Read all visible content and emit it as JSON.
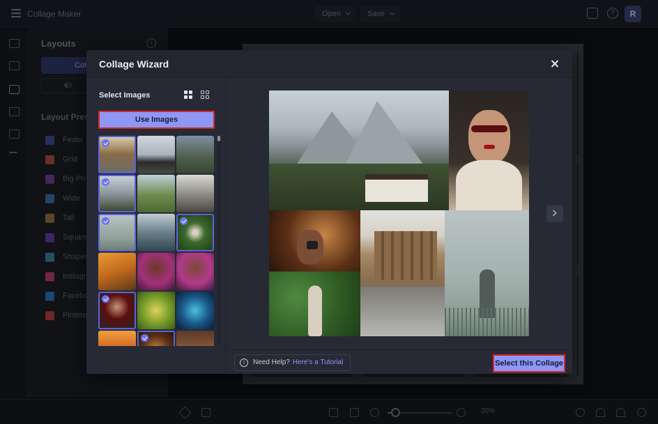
{
  "app": {
    "title": "Collage Maker",
    "menu_open": "Open",
    "menu_save": "Save",
    "avatar_initial": "R"
  },
  "left_panel": {
    "title": "Layouts",
    "tab_label": "Coll",
    "create_label": "Cr",
    "presets_title": "Layout Pres",
    "presets": [
      {
        "label": "Featu",
        "icon": "featured-icon"
      },
      {
        "label": "Grid",
        "icon": "grid-icon"
      },
      {
        "label": "Big Ph",
        "icon": "big-photo-icon"
      },
      {
        "label": "Wide",
        "icon": "wide-icon"
      },
      {
        "label": "Tall",
        "icon": "tall-icon"
      },
      {
        "label": "Square",
        "icon": "square-icon"
      },
      {
        "label": "Shapes",
        "icon": "shapes-icon"
      },
      {
        "label": "Instagr",
        "icon": "instagram-icon"
      },
      {
        "label": "Facebo",
        "icon": "facebook-icon"
      },
      {
        "label": "Pintere",
        "icon": "pinterest-icon"
      }
    ]
  },
  "wizard": {
    "title": "Collage Wizard",
    "select_images_label": "Select Images",
    "use_images_label": "Use Images",
    "help_text": "Need Help?",
    "help_link": "Here's a Tutorial",
    "select_collage_label": "Select this Collage",
    "thumbnails": [
      {
        "subject": "bath-architecture",
        "selected": true
      },
      {
        "subject": "black-church",
        "selected": false
      },
      {
        "subject": "coastal-hills",
        "selected": false
      },
      {
        "subject": "mountain-peaks",
        "selected": true
      },
      {
        "subject": "green-mountains",
        "selected": false
      },
      {
        "subject": "misty-mountain",
        "selected": false
      },
      {
        "subject": "silhouette-figure",
        "selected": true
      },
      {
        "subject": "mountain-lake",
        "selected": false
      },
      {
        "subject": "statue-ivy",
        "selected": true
      },
      {
        "subject": "tiger",
        "selected": false
      },
      {
        "subject": "woman-flowers",
        "selected": false
      },
      {
        "subject": "woman-flowers-2",
        "selected": false
      },
      {
        "subject": "woman-sunglasses",
        "selected": true
      },
      {
        "subject": "woman-green-light",
        "selected": false
      },
      {
        "subject": "neon-portrait",
        "selected": false
      },
      {
        "subject": "sunset-woman",
        "selected": false
      },
      {
        "subject": "camera-woman",
        "selected": true
      },
      {
        "subject": "cafe-interior",
        "selected": false
      }
    ]
  },
  "bottom": {
    "zoom_label": "20%",
    "zoom_fraction": 0.12
  },
  "colors": {
    "accent": "#8f97f5",
    "highlight_border": "#d62828",
    "modal_bg": "#272a35"
  }
}
